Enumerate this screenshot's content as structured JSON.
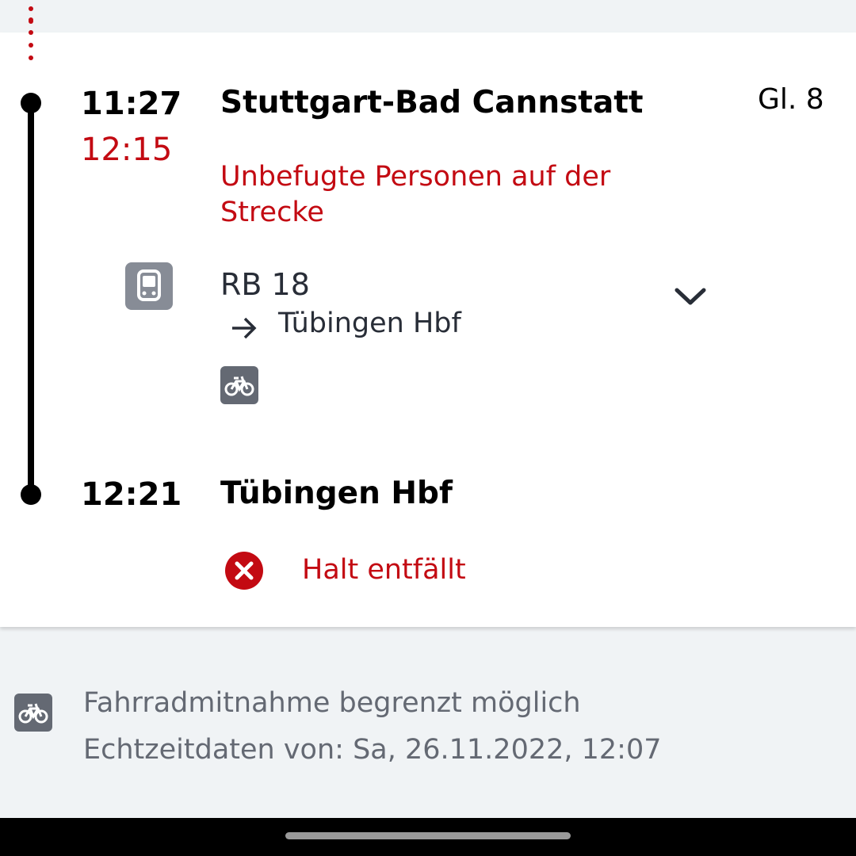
{
  "colors": {
    "accent_red": "#c30a12",
    "text_dark": "#282d37",
    "text_muted": "#646973",
    "icon_gray": "#878c96",
    "background": "#f0f3f5"
  },
  "leg": {
    "departure": {
      "time_planned": "11:27",
      "time_actual": "12:15",
      "station": "Stuttgart-Bad Cannstatt",
      "platform": "Gl. 8"
    },
    "disruption_message": "Unbefugte Personen auf der Strecke",
    "train": {
      "icon": "train-icon",
      "name": "RB 18",
      "arrow_icon": "arrow-right-icon",
      "destination": "Tübingen Hbf",
      "expand_icon": "chevron-down-icon",
      "bike_icon": "bicycle-icon"
    },
    "arrival": {
      "time_planned": "12:21",
      "station": "Tübingen Hbf",
      "cancel_icon": "close-circle-icon",
      "status": "Halt entfällt"
    }
  },
  "footer": {
    "bike_icon": "bicycle-icon",
    "bike_info": "Fahrradmitnahme begrenzt möglich",
    "realtime_info": "Echtzeitdaten von: Sa, 26.11.2022, 12:07"
  }
}
